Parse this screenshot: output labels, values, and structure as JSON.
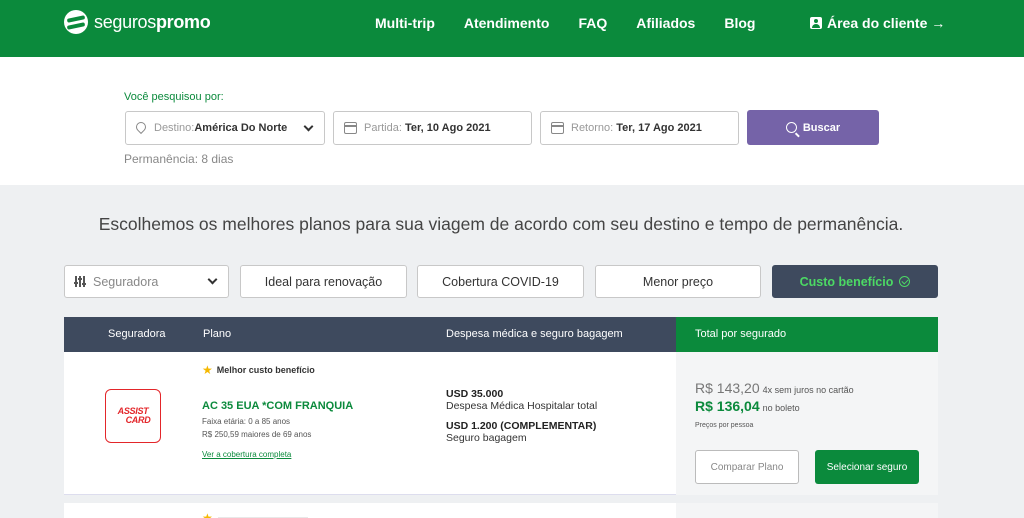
{
  "header": {
    "logo_light": "seguros",
    "logo_bold": "promo",
    "nav": [
      "Multi-trip",
      "Atendimento",
      "FAQ",
      "Afiliados",
      "Blog"
    ],
    "client_area": "Área do cliente →"
  },
  "search": {
    "label": "Você pesquisou por:",
    "destination_label": "Destino:",
    "destination_value": "América Do Norte",
    "departure_label": "Partida:",
    "departure_value": "Ter, 10 Ago 2021",
    "return_label": "Retorno:",
    "return_value": "Ter, 17 Ago 2021",
    "button": "Buscar",
    "stay": "Permanência: 8 dias"
  },
  "headline": "Escolhemos os melhores planos para sua viagem de acordo com seu destino e tempo de permanência.",
  "filters": {
    "insurer_placeholder": "Seguradora",
    "renewal": "Ideal para renovação",
    "covid": "Cobertura COVID-19",
    "lowest_price": "Menor preço",
    "best_value": "Custo benefício"
  },
  "table": {
    "headers": {
      "insurer": "Seguradora",
      "plan": "Plano",
      "expenses": "Despesa médica e seguro bagagem",
      "total": "Total por segurado"
    },
    "rows": [
      {
        "insurer_logo_line1": "ASSIST",
        "insurer_logo_line2": "CARD",
        "badge": "Melhor custo benefício",
        "plan_name": "AC 35 EUA *COM FRANQUIA",
        "age_range": "Faixa etária: 0 a 85 anos",
        "extra_age": "R$ 250,59 maiores de 69 anos",
        "coverage_link": "Ver a cobertura completa",
        "medical_amount": "USD 35.000",
        "medical_desc": "Despesa Médica Hospitalar total",
        "baggage_amount": "USD 1.200 (COMPLEMENTAR)",
        "baggage_desc": "Seguro bagagem",
        "price_card": "R$ 143,20",
        "price_card_note": "4x sem juros no cartão",
        "price_boleto": "R$ 136,04",
        "price_boleto_note": "no boleto",
        "per_person": "Preços por pessoa",
        "compare_button": "Comparar Plano",
        "select_button": "Selecionar seguro"
      }
    ]
  },
  "colors": {
    "brand_green": "#0b8a3c",
    "header_dark": "#3e4a5e",
    "search_purple": "#7563a8",
    "best_value_green": "#4cd964",
    "assist_red": "#e3262a",
    "star_yellow": "#f5b800"
  }
}
